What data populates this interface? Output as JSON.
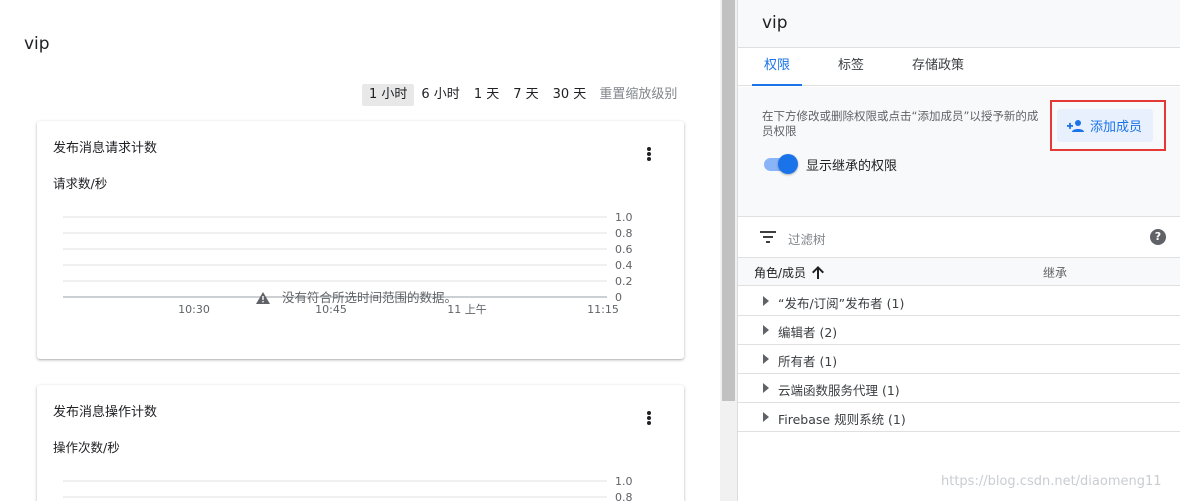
{
  "left": {
    "title": "vip",
    "time_range": {
      "options": [
        "1 小时",
        "6 小时",
        "1 天",
        "7 天",
        "30 天"
      ],
      "active_index": 0,
      "reset_label": "重置缩放级别"
    },
    "cards": [
      {
        "title": "发布消息请求计数",
        "subtitle": "请求数/秒",
        "empty_message": "没有符合所选时间范围的数据。",
        "chart_data": {
          "type": "line",
          "x_ticks": [
            "10:30",
            "10:45",
            "11 上午",
            "11:15"
          ],
          "y_ticks": [
            "1.0",
            "0.8",
            "0.6",
            "0.4",
            "0.2",
            "0"
          ],
          "ylim": [
            0,
            1
          ],
          "series": []
        }
      },
      {
        "title": "发布消息操作计数",
        "subtitle": "操作次数/秒",
        "chart_data": {
          "type": "line",
          "y_ticks": [
            "1.0",
            "0.8"
          ],
          "ylim": [
            0,
            1
          ],
          "series": []
        }
      }
    ]
  },
  "panel": {
    "title": "vip",
    "tabs": [
      "权限",
      "标签",
      "存储政策"
    ],
    "active_tab": 0,
    "info_text": "在下方修改或删除权限或点击“添加成员”以授予新的成员权限",
    "add_member_label": "添加成员",
    "toggle_label": "显示继承的权限",
    "toggle_on": true,
    "filter_placeholder": "过滤树",
    "table": {
      "col_role": "角色/成员",
      "col_inherit": "继承",
      "rows": [
        "“发布/订阅”发布者 (1)",
        "编辑者 (2)",
        "所有者 (1)",
        "云端函数服务代理 (1)",
        "Firebase 规则系统 (1)"
      ]
    }
  },
  "watermark": "https://blog.csdn.net/diaomeng11",
  "colors": {
    "accent": "#1a73e8",
    "highlight_box": "#e53935"
  }
}
